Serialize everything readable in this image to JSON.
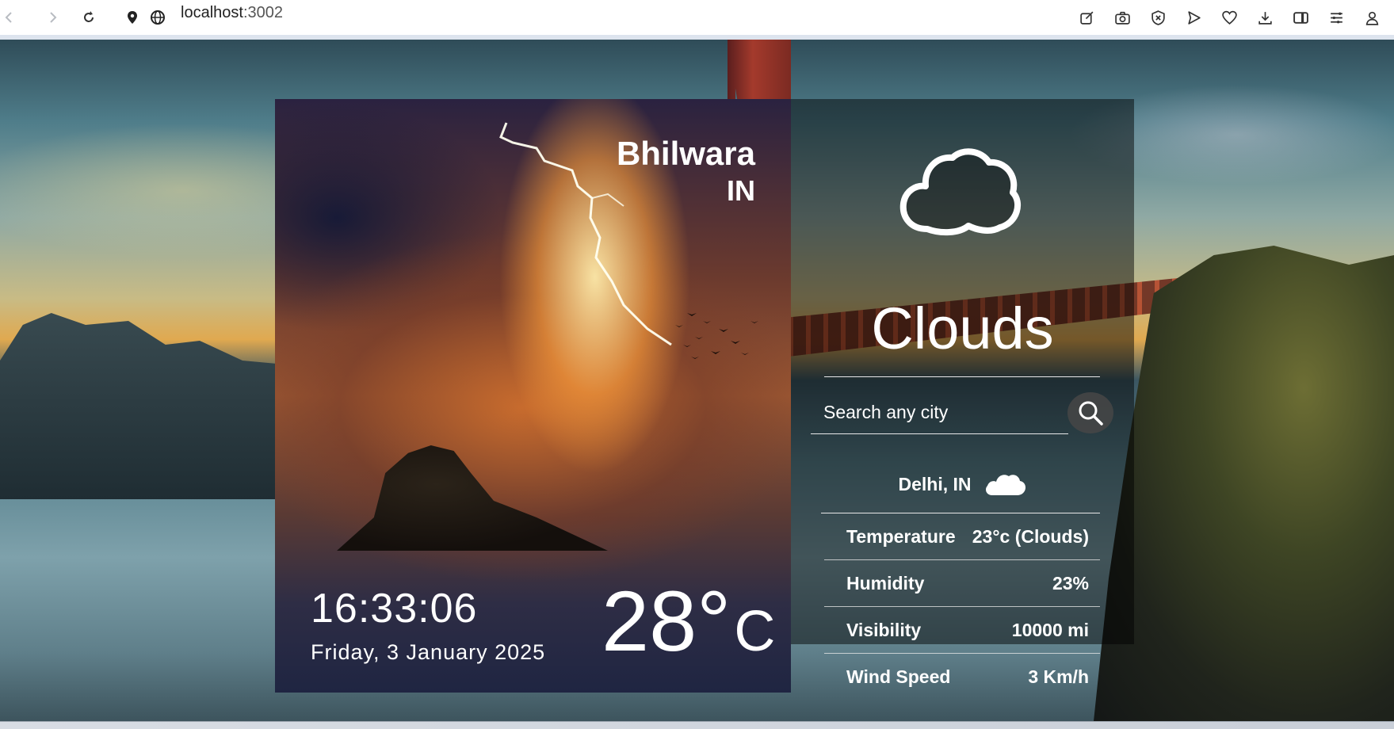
{
  "browser": {
    "url_host": "localhost",
    "url_port": ":3002"
  },
  "weather": {
    "city": "Bhilwara",
    "country": "IN",
    "time": "16:33:06",
    "date": "Friday, 3 January 2025",
    "temperature": "28°",
    "temperature_unit": "C",
    "condition": "Clouds"
  },
  "search": {
    "placeholder": "Search any city"
  },
  "result": {
    "location": "Delhi, IN",
    "rows": [
      {
        "label": "Temperature",
        "value": "23°c (Clouds)"
      },
      {
        "label": "Humidity",
        "value": "23%"
      },
      {
        "label": "Visibility",
        "value": "10000 mi"
      },
      {
        "label": "Wind Speed",
        "value": "3 Km/h"
      }
    ]
  }
}
